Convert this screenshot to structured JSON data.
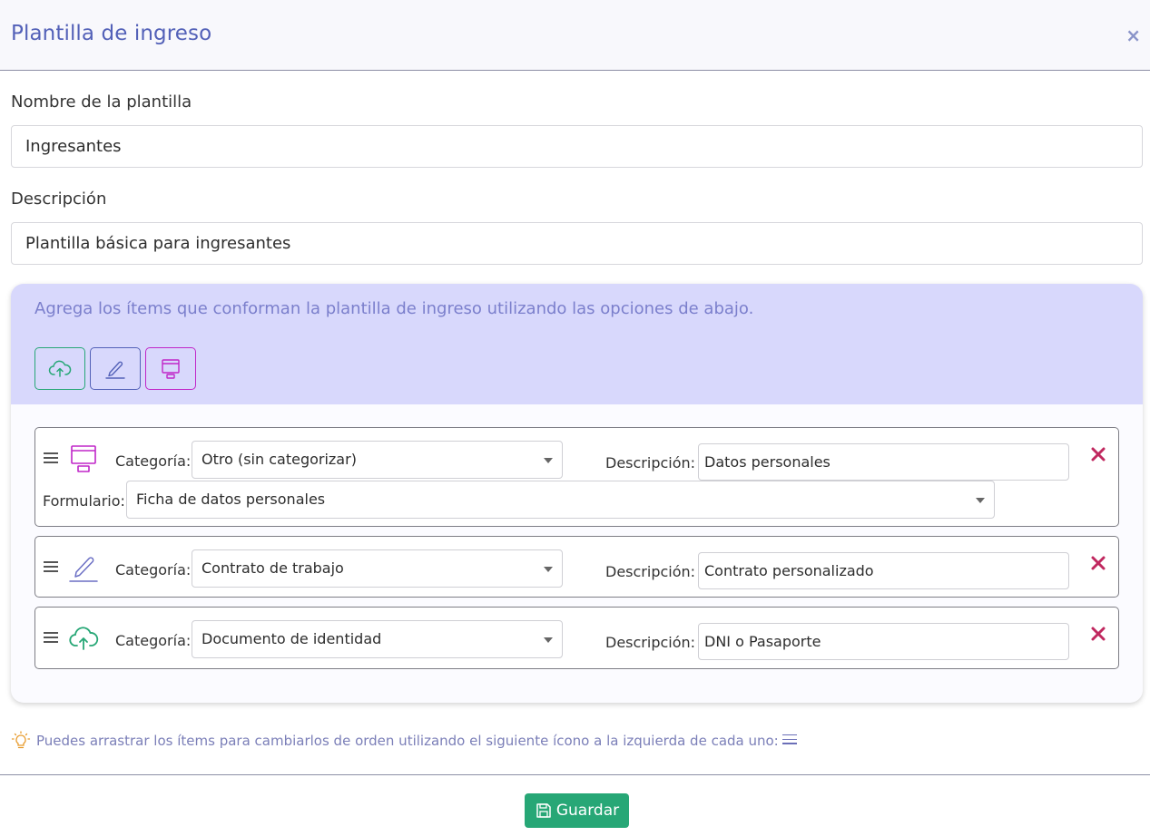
{
  "dialog": {
    "title": "Plantilla de ingreso",
    "close_label": "×"
  },
  "form": {
    "name_label": "Nombre de la plantilla",
    "name_value": "Ingresantes",
    "description_label": "Descripción",
    "description_value": "Plantilla básica para ingresantes"
  },
  "panel": {
    "intro": "Agrega los ítems que conforman la plantilla de ingreso utilizando las opciones de abajo.",
    "tools": [
      {
        "icon": "cloud-upload-icon",
        "color": "#27a776"
      },
      {
        "icon": "signature-pen-icon",
        "color": "#5361b8"
      },
      {
        "icon": "form-window-icon",
        "color": "#c026c8"
      }
    ]
  },
  "items": [
    {
      "icon": "form-window-icon",
      "category_label": "Categoría:",
      "category_value": "Otro (sin categorizar)",
      "description_label": "Descripción:",
      "description_value": "Datos personales",
      "form_label": "Formulario:",
      "form_value": "Ficha de datos personales"
    },
    {
      "icon": "signature-pen-icon",
      "category_label": "Categoría:",
      "category_value": "Contrato de trabajo",
      "description_label": "Descripción:",
      "description_value": "Contrato personalizado"
    },
    {
      "icon": "cloud-upload-icon",
      "category_label": "Categoría:",
      "category_value": "Documento de identidad",
      "description_label": "Descripción:",
      "description_value": "DNI o Pasaporte"
    }
  ],
  "hint": {
    "text": "Puedes arrastrar los ítems para cambiarlos de orden utilizando el siguiente ícono a la izquierda de cada uno:"
  },
  "footer": {
    "save_label": "Guardar"
  },
  "colors": {
    "accent": "#5361b8",
    "panel_bg": "#d8d8fc",
    "success": "#27a776",
    "danger": "#c0285f",
    "form_icon": "#c026c8"
  }
}
